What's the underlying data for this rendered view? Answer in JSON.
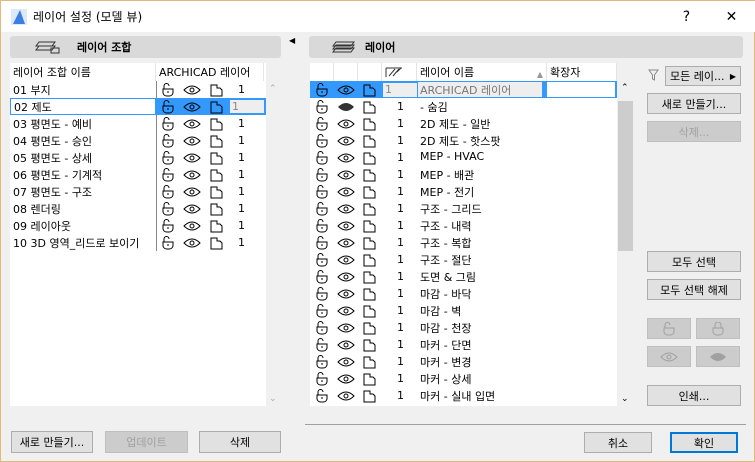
{
  "window": {
    "title": "레이어 설정 (모델 뷰)",
    "help": "?",
    "close": "✕"
  },
  "left": {
    "header": "레이어 조합",
    "columns": [
      "레이어 조합 이름",
      "ARCHICAD 레이어"
    ],
    "rows": [
      {
        "name": "01 부지",
        "count": "1"
      },
      {
        "name": "02 제도",
        "count": "1",
        "selected": true
      },
      {
        "name": "03 평면도 - 예비",
        "count": "1"
      },
      {
        "name": "04 평면도 - 승인",
        "count": "1"
      },
      {
        "name": "05 평면도 - 상세",
        "count": "1"
      },
      {
        "name": "06 평면도 - 기계적",
        "count": "1"
      },
      {
        "name": "07 평면도 - 구조",
        "count": "1"
      },
      {
        "name": "08 렌더링",
        "count": "1"
      },
      {
        "name": "09 레이아웃",
        "count": "1"
      },
      {
        "name": "10 3D 영역_리드로 보이기",
        "count": "1"
      }
    ],
    "buttons": {
      "new": "새로 만들기...",
      "update": "업데이트",
      "delete": "삭제"
    }
  },
  "right": {
    "header": "레이어",
    "columns": {
      "name": "레이어 이름",
      "ext": "확장자"
    },
    "rows": [
      {
        "num": "1",
        "name": "ARCHICAD 레이어",
        "selected": true
      },
      {
        "num": "1",
        "name": "- 숨김",
        "hidden": true
      },
      {
        "num": "1",
        "name": "2D 제도 - 일반"
      },
      {
        "num": "1",
        "name": "2D 제도 - 핫스팟"
      },
      {
        "num": "1",
        "name": "MEP - HVAC"
      },
      {
        "num": "1",
        "name": "MEP - 배관"
      },
      {
        "num": "1",
        "name": "MEP - 전기"
      },
      {
        "num": "1",
        "name": "구조 - 그리드"
      },
      {
        "num": "1",
        "name": "구조 - 내력"
      },
      {
        "num": "1",
        "name": "구조 - 복합"
      },
      {
        "num": "1",
        "name": "구조 - 절단"
      },
      {
        "num": "1",
        "name": "도면 & 그림"
      },
      {
        "num": "1",
        "name": "마감 - 바닥"
      },
      {
        "num": "1",
        "name": "마감 - 벽"
      },
      {
        "num": "1",
        "name": "마감 - 천장"
      },
      {
        "num": "1",
        "name": "마커 - 단면"
      },
      {
        "num": "1",
        "name": "마커 - 변경"
      },
      {
        "num": "1",
        "name": "마커 - 상세"
      },
      {
        "num": "1",
        "name": "마커 - 실내 입면"
      }
    ],
    "filter": "모든 레이...",
    "buttons": {
      "new": "새로 만들기...",
      "delete": "삭제...",
      "select_all": "모두 선택",
      "deselect_all": "모두 선택 해제",
      "print": "인쇄..."
    }
  },
  "footer": {
    "cancel": "취소",
    "ok": "확인"
  },
  "colors": {
    "selection": "#3399ff",
    "default_border": "#0078d7"
  }
}
